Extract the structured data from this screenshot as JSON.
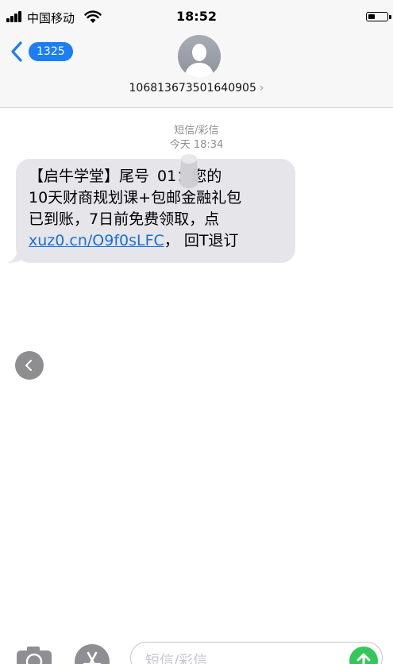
{
  "status_bar": {
    "carrier": "中国移动",
    "time": "18:52",
    "battery_level": 0.4
  },
  "header": {
    "back_badge": "1325",
    "contact_number": "106813673501640905"
  },
  "thread": {
    "message_type": "短信/彩信",
    "timestamp": "今天 18:34",
    "message": {
      "line1": "【启牛学堂】尾号",
      "line1_rest": "01：您的",
      "line2": "10天财商规划课+包邮金融礼包",
      "line3": "已到账，7日前免费领取，点",
      "link": "xuz0.cn/O9f0sLFC",
      "line4_rest": "， 回T退订"
    }
  },
  "composer": {
    "placeholder": "短信/彩信"
  },
  "colors": {
    "accent": "#1a7ef5",
    "bubble": "#e5e5ea",
    "link": "#1a6fd6",
    "send": "#34c759"
  }
}
